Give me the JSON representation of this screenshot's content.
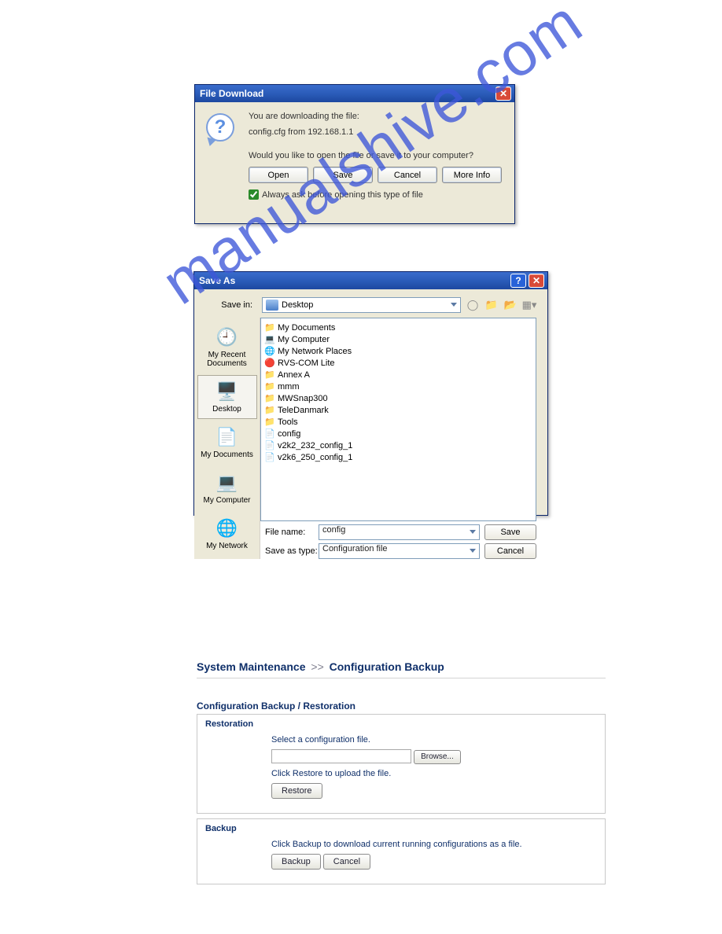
{
  "file_download": {
    "title": "File Download",
    "line1": "You are downloading the file:",
    "line2": "config.cfg from 192.168.1.1",
    "line3": "Would you like to open the file or save it to your computer?",
    "buttons": {
      "open": "Open",
      "save": "Save",
      "cancel": "Cancel",
      "more": "More Info"
    },
    "checkbox_label": "Always ask before opening this type of file",
    "checkbox_checked": true
  },
  "save_as": {
    "title": "Save As",
    "save_in_label": "Save in:",
    "save_in_value": "Desktop",
    "places": [
      {
        "label": "My Recent Documents"
      },
      {
        "label": "Desktop"
      },
      {
        "label": "My Documents"
      },
      {
        "label": "My Computer"
      },
      {
        "label": "My Network"
      }
    ],
    "files": [
      {
        "name": "My Documents",
        "icon": "mydoc"
      },
      {
        "name": "My Computer",
        "icon": "mycomp"
      },
      {
        "name": "My Network Places",
        "icon": "net"
      },
      {
        "name": "RVS-COM Lite",
        "icon": "rvs"
      },
      {
        "name": "Annex A",
        "icon": "folder"
      },
      {
        "name": "mmm",
        "icon": "folder"
      },
      {
        "name": "MWSnap300",
        "icon": "folder"
      },
      {
        "name": "TeleDanmark",
        "icon": "folder"
      },
      {
        "name": "Tools",
        "icon": "folder"
      },
      {
        "name": "config",
        "icon": "file"
      },
      {
        "name": "v2k2_232_config_1",
        "icon": "file"
      },
      {
        "name": "v2k6_250_config_1",
        "icon": "file"
      }
    ],
    "filename_label": "File name:",
    "filename_value": "config",
    "filetype_label": "Save as type:",
    "filetype_value": "Configuration file",
    "save_btn": "Save",
    "cancel_btn": "Cancel"
  },
  "watermark": "manualshive.com",
  "web": {
    "breadcrumb_a": "System Maintenance",
    "breadcrumb_b": "Configuration Backup",
    "section_title": "Configuration Backup / Restoration",
    "restoration": {
      "legend": "Restoration",
      "select_label": "Select a configuration file.",
      "browse": "Browse...",
      "hint": "Click Restore to upload the file.",
      "restore": "Restore"
    },
    "backup": {
      "legend": "Backup",
      "hint": "Click Backup to download current running configurations as a file.",
      "backup": "Backup",
      "cancel": "Cancel"
    }
  }
}
